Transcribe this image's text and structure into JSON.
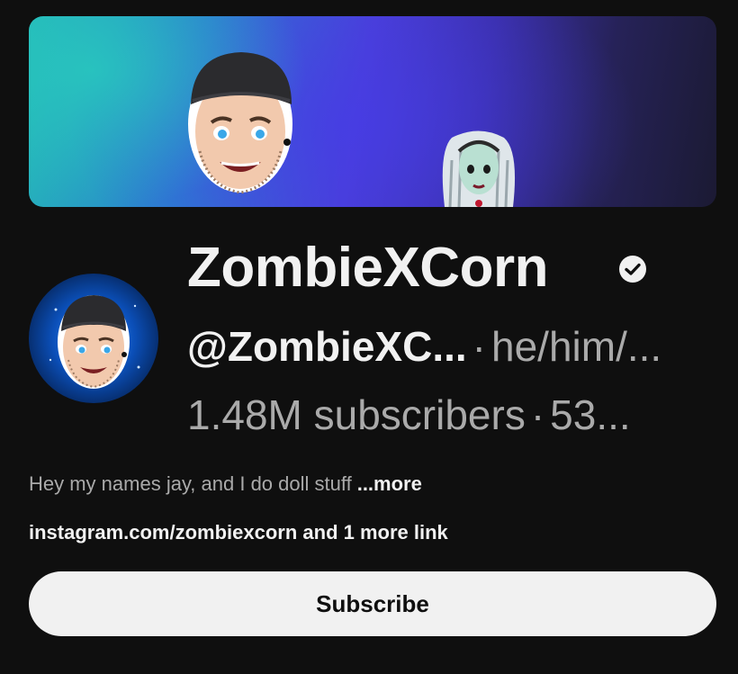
{
  "channel": {
    "name": "ZombieXCorn",
    "verified_icon": "verified-check-icon",
    "handle": "@ZombieXC...",
    "pronouns": "he/him/...",
    "subscribers": "1.48M subscribers",
    "videos": "53...",
    "separator": "·"
  },
  "about": {
    "description": "Hey my names jay, and I do doll stuff",
    "more_label": "...more",
    "links_text": "instagram.com/zombiexcorn and 1 more link"
  },
  "actions": {
    "subscribe_label": "Subscribe"
  },
  "colors": {
    "background": "#0f0f0f",
    "primary_text": "#f1f1f1",
    "secondary_text": "#aaaaaa",
    "button_bg": "#f1f1f1"
  }
}
